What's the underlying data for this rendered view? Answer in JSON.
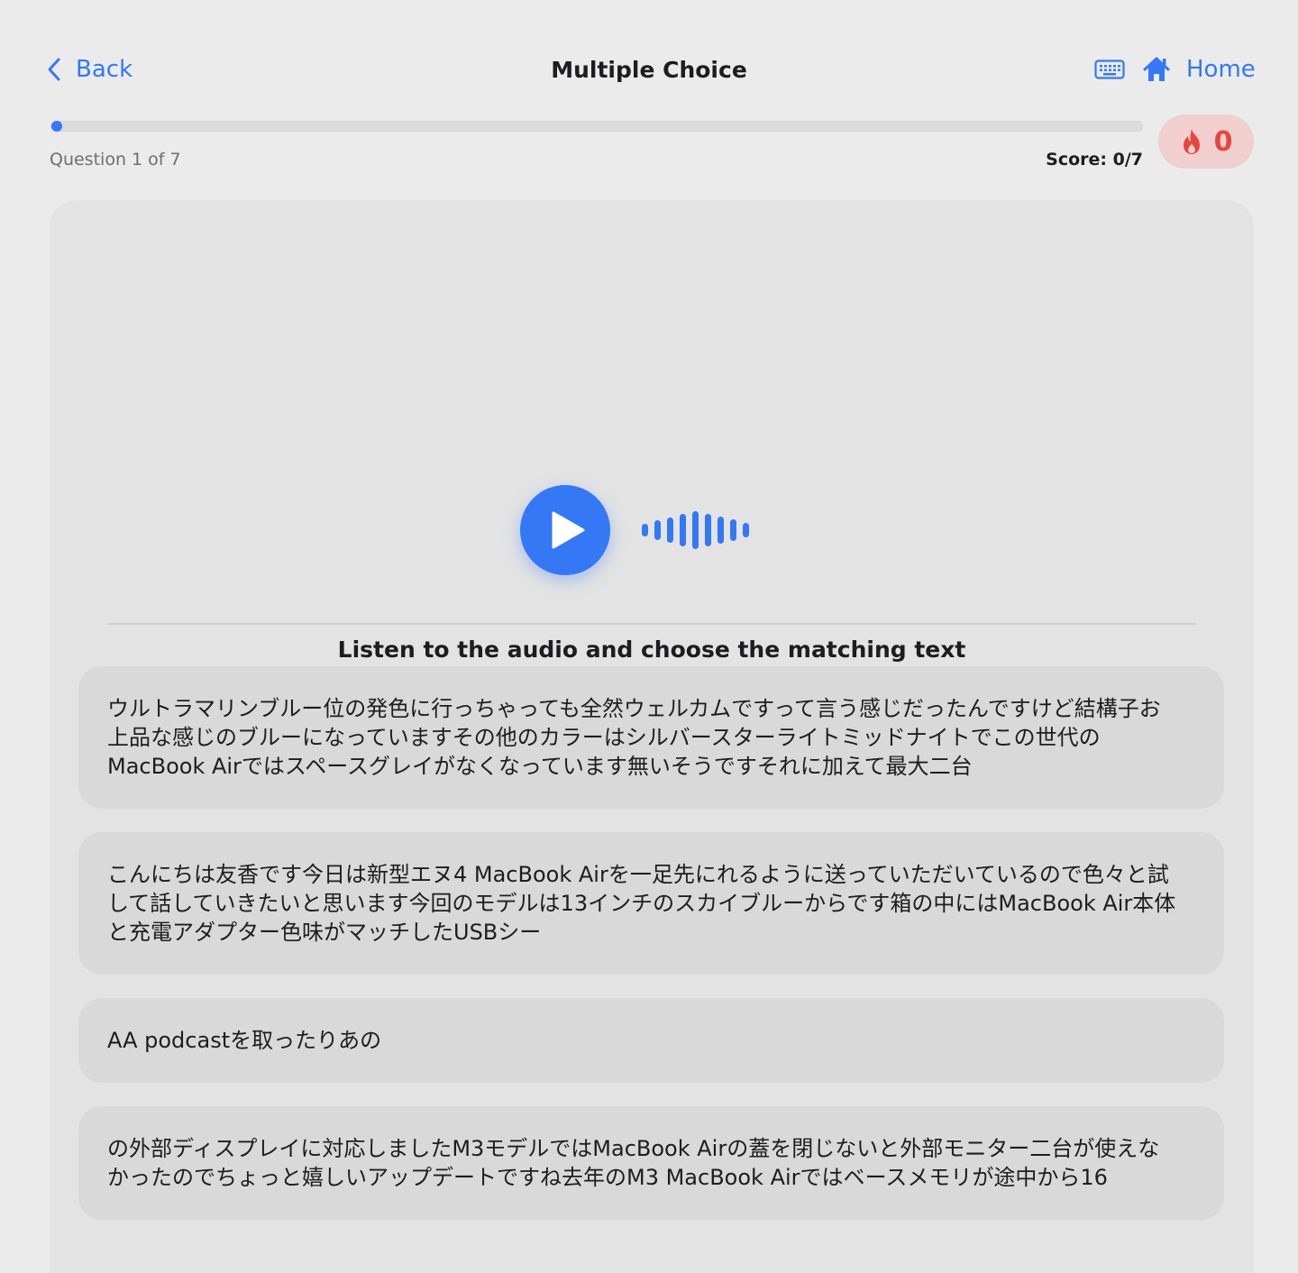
{
  "header": {
    "back_label": "Back",
    "title": "Multiple Choice",
    "home_label": "Home"
  },
  "progress": {
    "question_label": "Question 1 of 7",
    "current_question": 1,
    "total_questions": 7,
    "fraction_complete": 0.0,
    "score_label": "Score: 0/7",
    "streak_count": "0"
  },
  "quiz": {
    "prompt": "Listen to the audio and choose the matching text",
    "options": [
      {
        "text": "ウルトラマリンブルー位の発色に行っちゃっても全然ウェルカムですって言う感じだったんですけど結構子お上品な感じのブルーになっていますその他のカラーはシルバースターライトミッドナイトでこの世代のMacBook Airではスペースグレイがなくなっています無いそうですそれに加えて最大二台"
      },
      {
        "text": "こんにちは友香です今日は新型エヌ4 MacBook Airを一足先にれるように送っていただいているので色々と試して話していきたいと思います今回のモデルは13インチのスカイブルーからです箱の中にはMacBook Air本体と充電アダプター色味がマッチしたUSBシー"
      },
      {
        "text": "AA podcastを取ったりあの"
      },
      {
        "text": "の外部ディスプレイに対応しましたM3モデルではMacBook Airの蓋を閉じないと外部モニター二台が使えなかったのでちょっと嬉しいアップデートですね去年のM3 MacBook Airではベースメモリが途中から16"
      }
    ]
  },
  "colors": {
    "accent": "#3478f6",
    "streak": "#e8453c",
    "streak_bg": "#f1cfcf",
    "background": "#ebebeb",
    "card": "#e3e3e3",
    "option": "#d9d9d9"
  },
  "icons": {
    "back": "chevron-left-icon",
    "keyboard": "keyboard-icon",
    "home": "house-icon",
    "streak": "flame-icon",
    "play": "play-icon",
    "audio": "waveform-icon"
  }
}
